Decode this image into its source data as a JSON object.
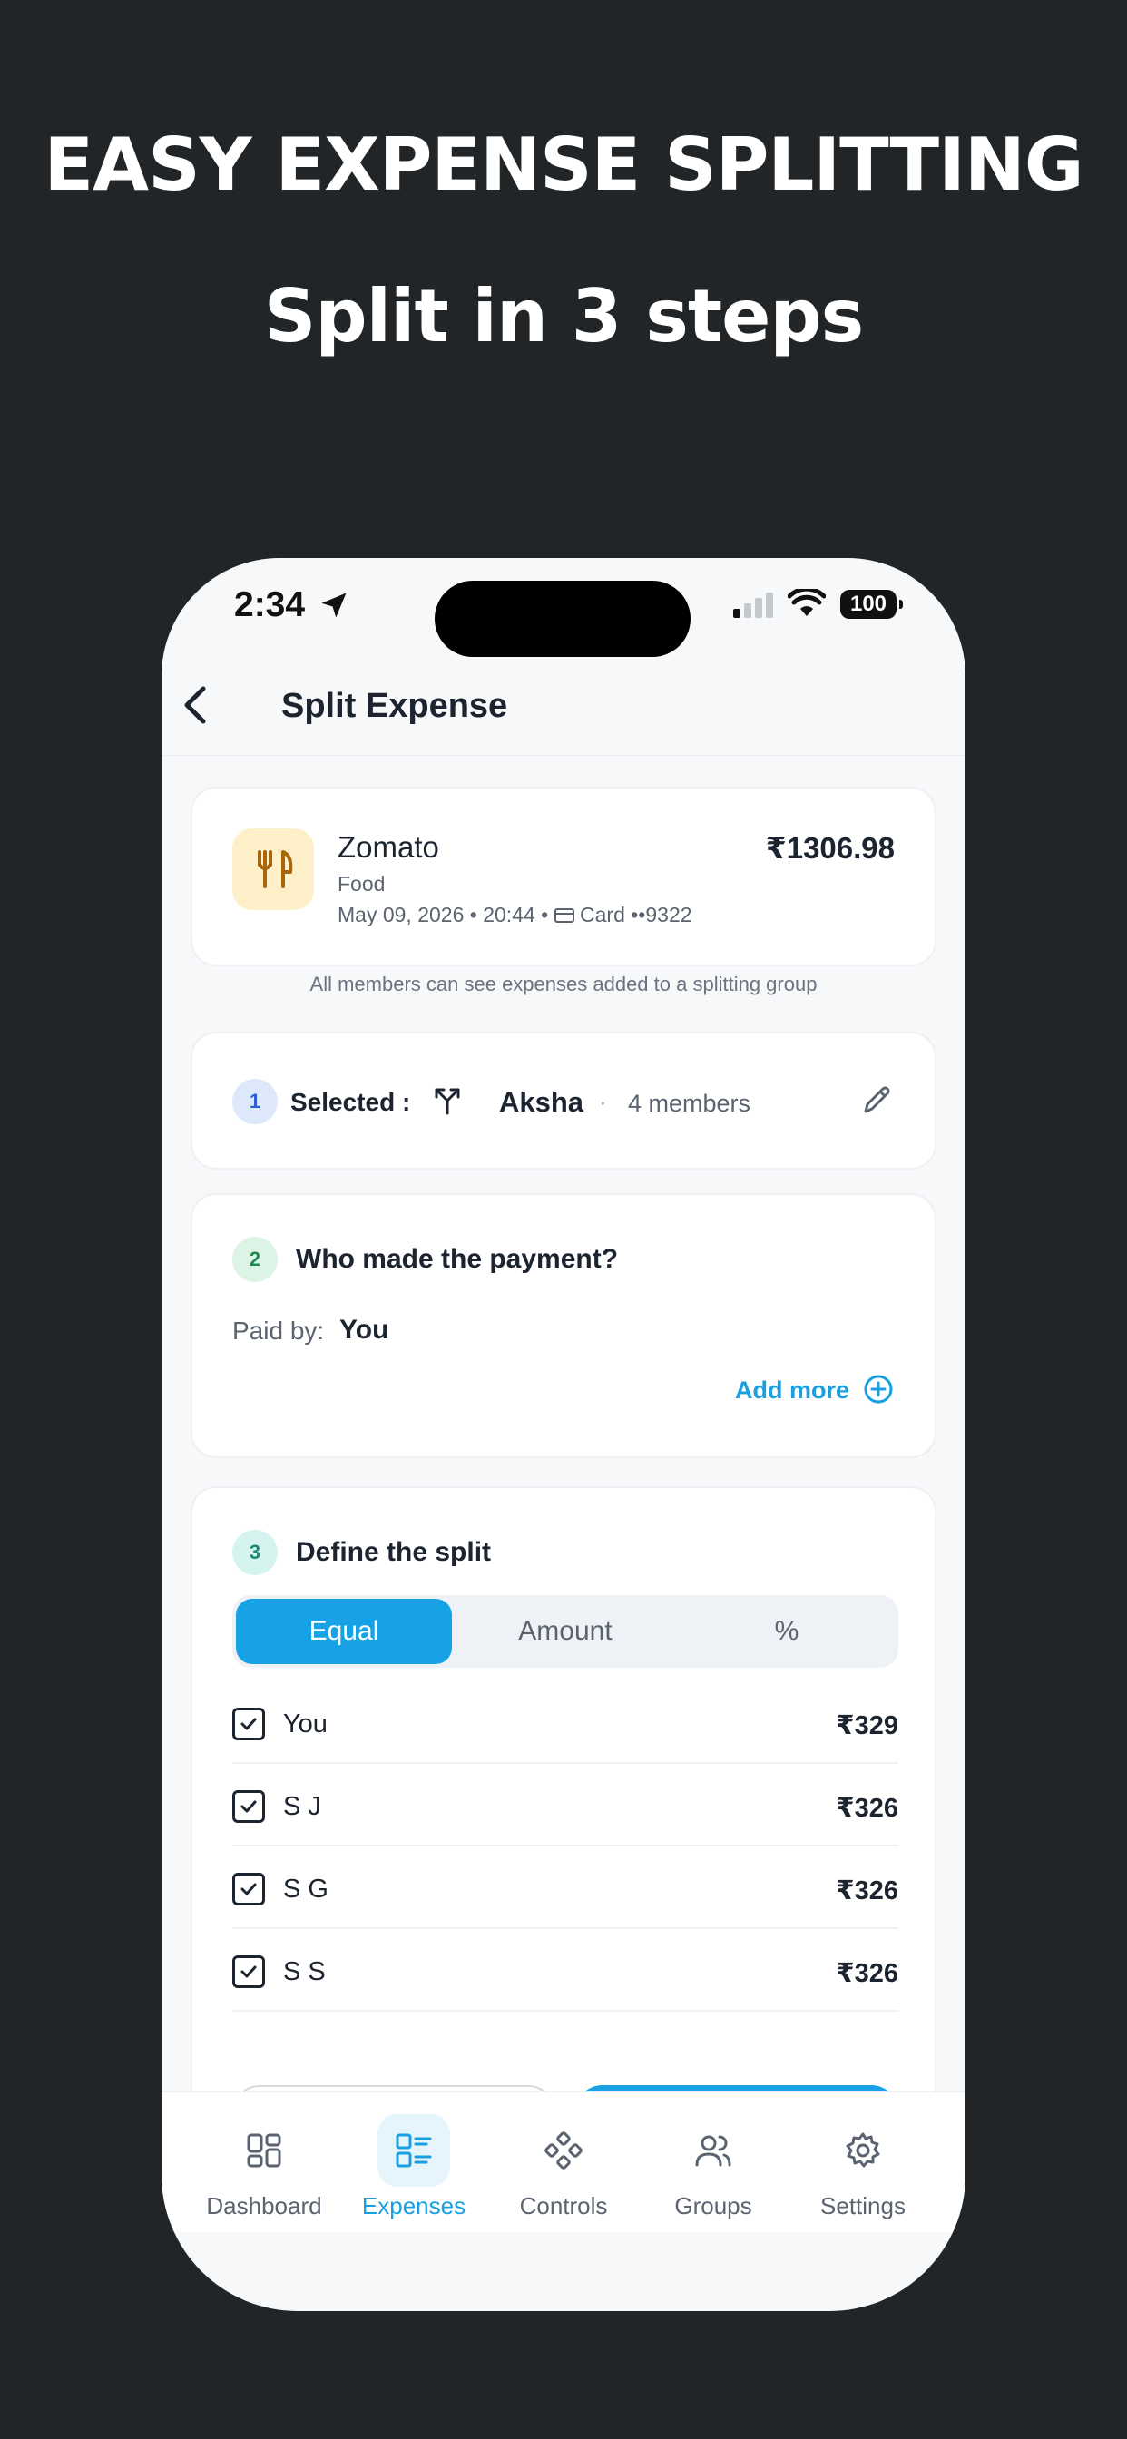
{
  "promo": {
    "headline": "EASY EXPENSE SPLITTING",
    "subheadline": "Split in 3 steps"
  },
  "status_bar": {
    "time": "2:34",
    "battery": "100"
  },
  "nav": {
    "title": "Split Expense"
  },
  "expense": {
    "merchant": "Zomato",
    "category": "Food",
    "date": "May 09, 2026",
    "time": "20:44",
    "payment_method": "Card ••9322",
    "amount": "₹1306.98",
    "icon": "fork-knife-icon"
  },
  "group_note": "All members can see expenses added to a splitting group",
  "step1": {
    "number": "1",
    "label": "Selected :",
    "group_name": "Aksha",
    "separator": "·",
    "members": "4 members"
  },
  "step2": {
    "number": "2",
    "question": "Who made the payment?",
    "paid_by_label": "Paid by:",
    "paid_by_value": "You",
    "add_more": "Add more"
  },
  "step3": {
    "number": "3",
    "title": "Define the split",
    "modes": [
      "Equal",
      "Amount",
      "%"
    ],
    "selected_mode": "Equal",
    "members": [
      {
        "name": "You",
        "amount": "₹329",
        "checked": true
      },
      {
        "name": "S J",
        "amount": "₹326",
        "checked": true
      },
      {
        "name": "S G",
        "amount": "₹326",
        "checked": true
      },
      {
        "name": "S S",
        "amount": "₹326",
        "checked": true
      }
    ]
  },
  "tabs": [
    {
      "label": "Dashboard",
      "icon": "dashboard-icon",
      "active": false
    },
    {
      "label": "Expenses",
      "icon": "expenses-icon",
      "active": true
    },
    {
      "label": "Controls",
      "icon": "controls-icon",
      "active": false
    },
    {
      "label": "Groups",
      "icon": "groups-icon",
      "active": false
    },
    {
      "label": "Settings",
      "icon": "settings-icon",
      "active": false
    }
  ],
  "colors": {
    "background": "#222527",
    "accent": "#18a2e6",
    "text": "#1c2430"
  }
}
